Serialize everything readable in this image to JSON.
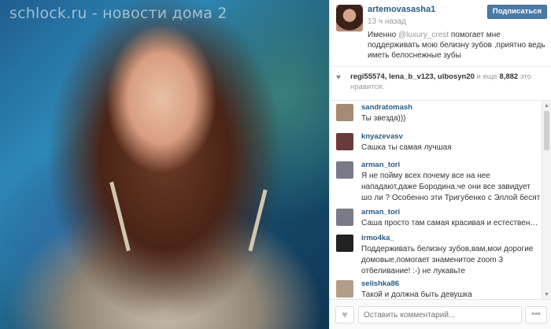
{
  "photo": {
    "watermark": "schlock.ru - новости дома 2"
  },
  "post": {
    "username": "artemovasasha1",
    "time": "13 ч назад",
    "follow_label": "Подписаться",
    "caption_prefix": "Именно ",
    "caption_mention": "@luxury_crest",
    "caption_suffix": " помогает мне поддерживать мою белизну зубов ,приятно ведь иметь белоснежные зубы"
  },
  "likes": {
    "users": "regi55574, lena_b_v123, ulbosyn20",
    "count_prefix": " и еще ",
    "count": "8,882",
    "count_suffix": " это нравится."
  },
  "comments": [
    {
      "user": "sandratomash",
      "text": "Ты звезда)))",
      "avatar_color": "#a58b74"
    },
    {
      "user": "knyazevasv",
      "text": "Сашка ты самая лучшая",
      "avatar_color": "#6b3a3a"
    },
    {
      "user": "arman_tori",
      "text": "Я не пойму всех почему все на нее нападают,даже Бородина.че они все завидует шо ли ? Особенно эти Тригубенко с Эллой бесят",
      "avatar_color": "#7a7a8a"
    },
    {
      "user": "arman_tori",
      "text": "Саша просто там самая красивая и естественная...",
      "avatar_color": "#7a7a8a"
    },
    {
      "user": "irmo4ka_",
      "text": "Поддерживать белизну зубов,вам,мои дорогие домовые,помогает знаменитое zoom 3 отбеливание! :-) не лукавьте",
      "avatar_color": "#222222"
    },
    {
      "user": "selishka86",
      "text": "Такой и должна быть девушка",
      "avatar_color": "#b59c88"
    }
  ],
  "footer": {
    "comment_placeholder": "Оставить комментарий...",
    "more_label": "•••"
  },
  "colors": {
    "link": "#2a5b83",
    "follow_bg": "#4a7aa6"
  }
}
